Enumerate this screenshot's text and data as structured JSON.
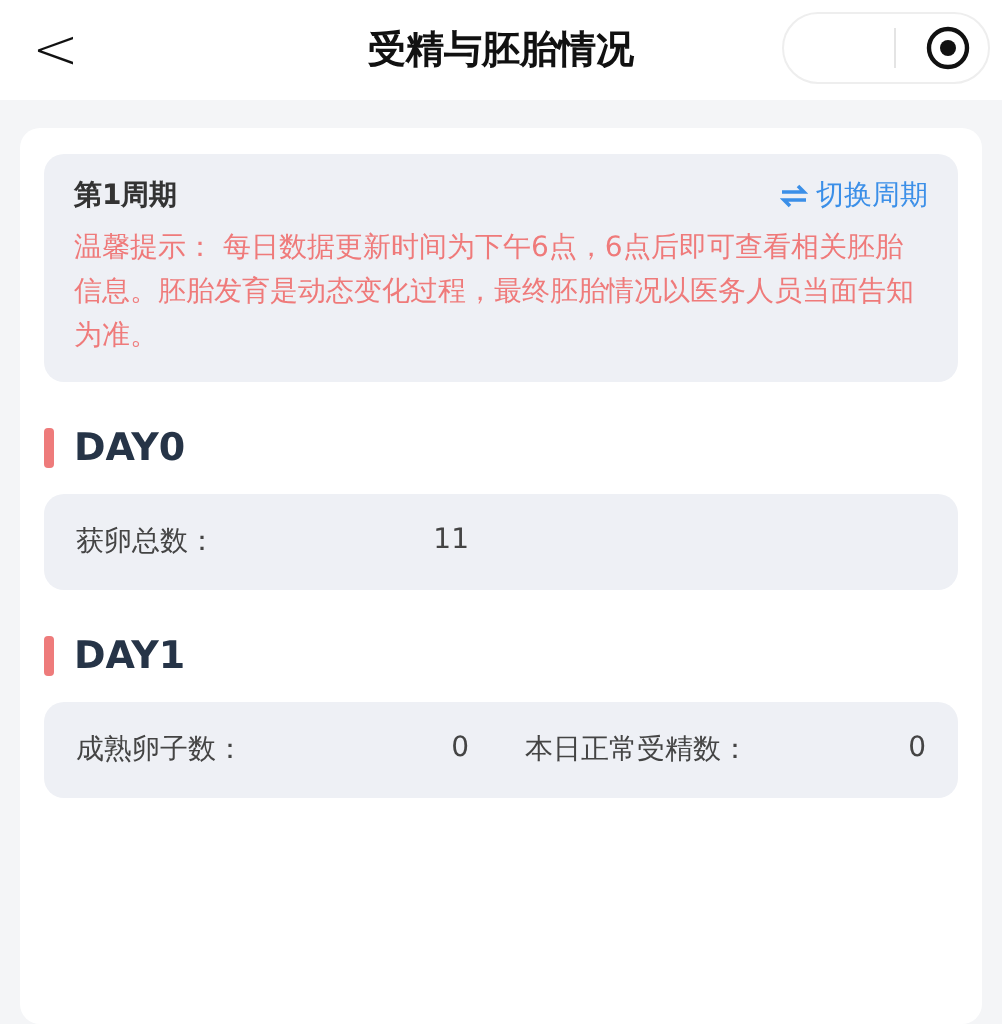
{
  "nav": {
    "back": "<",
    "title": "受精与胚胎情况"
  },
  "cycle": {
    "name": "第1周期",
    "switch_label": "切换周期",
    "notice": "温馨提示： 每日数据更新时间为下午6点，6点后即可查看相关胚胎信息。胚胎发育是动态变化过程，最终胚胎情况以医务人员当面告知为准。"
  },
  "days": [
    {
      "title": "DAY0",
      "metrics": [
        {
          "label": "获卵总数：",
          "value": "11"
        }
      ]
    },
    {
      "title": "DAY1",
      "metrics": [
        {
          "label": "成熟卵子数：",
          "value": "0"
        },
        {
          "label": "本日正常受精数：",
          "value": "0"
        }
      ]
    }
  ]
}
